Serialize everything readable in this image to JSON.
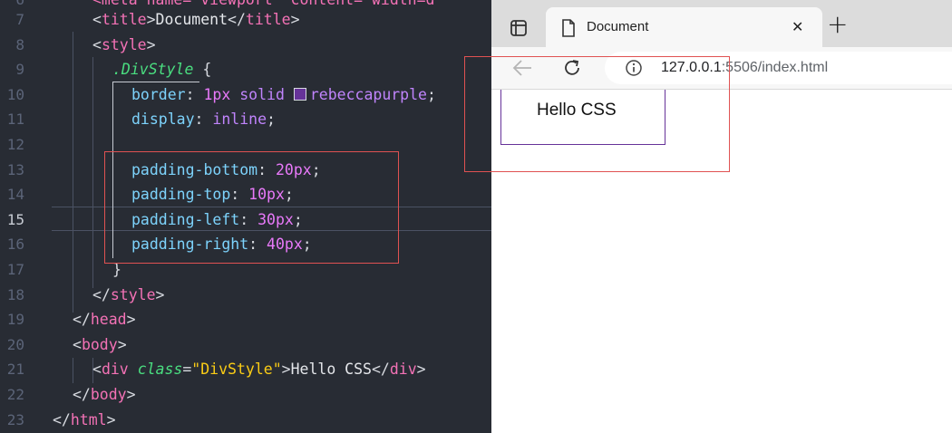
{
  "editor": {
    "lines": [
      {
        "n": "6",
        "partial": "<meta name=\"viewport\" content=\"width=d"
      },
      {
        "n": "7"
      },
      {
        "n": "8"
      },
      {
        "n": "9"
      },
      {
        "n": "10"
      },
      {
        "n": "11"
      },
      {
        "n": "12"
      },
      {
        "n": "13"
      },
      {
        "n": "14"
      },
      {
        "n": "15"
      },
      {
        "n": "16"
      },
      {
        "n": "17"
      },
      {
        "n": "18"
      },
      {
        "n": "19"
      },
      {
        "n": "20"
      },
      {
        "n": "21"
      },
      {
        "n": "22"
      },
      {
        "n": "23"
      }
    ],
    "tokens": {
      "lt": "<",
      "gt": ">",
      "lts": "</",
      "title_tag": "title",
      "title_text": "Document",
      "style_tag": "style",
      "selector": ".DivStyle",
      "brace_open": "{",
      "brace_close": "}",
      "p_border": "border",
      "colon": ":",
      "v_border_num": "1px",
      "v_border_kw": "solid",
      "v_border_color": "rebeccapurple",
      "semi": ";",
      "p_display": "display",
      "v_display": "inline",
      "p_pb": "padding-bottom",
      "v_pb": "20px",
      "p_pt": "padding-top",
      "v_pt": "10px",
      "p_pl": "padding-left",
      "v_pl": "30px",
      "p_pr": "padding-right",
      "v_pr": "40px",
      "head_tag": "head",
      "body_tag": "body",
      "div_tag": "div",
      "attr_class": "class",
      "eq": "=",
      "class_val": "\"DivStyle\"",
      "div_text": "Hello CSS",
      "html_tag": "html"
    },
    "active_line": "15",
    "swatch_color": "#663399"
  },
  "browser": {
    "tab_title": "Document",
    "url_host": "127.0.0.1",
    "url_path": ":5506/index.html",
    "rendered_text": "Hello CSS",
    "new_tab_symbol": "+",
    "close_symbol": "✕",
    "icons": [
      "sidebar-icon",
      "document-icon",
      "back-arrow-icon",
      "reload-icon",
      "info-icon"
    ]
  },
  "colors": {
    "accent": "#663399",
    "annotation": "#e05252"
  }
}
